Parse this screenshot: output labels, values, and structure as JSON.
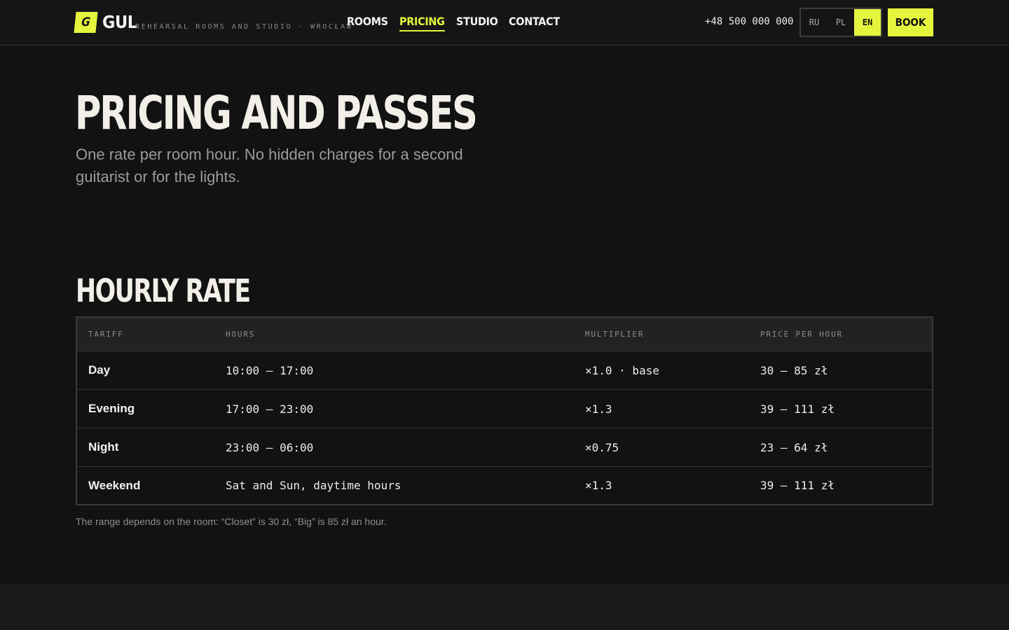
{
  "header": {
    "logo_mark": "G",
    "logo_name": "GUL",
    "tagline": "REHEARSAL ROOMS AND STUDIO · WROCŁAW",
    "nav": [
      {
        "label": "ROOMS"
      },
      {
        "label": "PRICING",
        "active": true
      },
      {
        "label": "STUDIO"
      },
      {
        "label": "CONTACT"
      }
    ],
    "phone": "+48 500 000 000",
    "languages": [
      {
        "label": "RU"
      },
      {
        "label": "PL"
      },
      {
        "label": "EN",
        "active": true
      }
    ],
    "book_label": "BOOK"
  },
  "hero": {
    "title": "PRICING AND PASSES",
    "subtitle": "One rate per room hour. No hidden charges for a second guitarist or for the lights."
  },
  "hourly": {
    "title": "HOURLY RATE",
    "columns": [
      "TARIFF",
      "HOURS",
      "MULTIPLIER",
      "PRICE PER HOUR"
    ],
    "rows": [
      {
        "tariff": "Day",
        "hours": "10:00 — 17:00",
        "multiplier": "×1.0 · base",
        "price": "30 — 85 zł"
      },
      {
        "tariff": "Evening",
        "hours": "17:00 — 23:00",
        "multiplier": "×1.3",
        "price": "39 — 111 zł"
      },
      {
        "tariff": "Night",
        "hours": "23:00 — 06:00",
        "multiplier": "×0.75",
        "price": "23 — 64 zł"
      },
      {
        "tariff": "Weekend",
        "hours": "Sat and Sun, daytime hours",
        "multiplier": "×1.3",
        "price": "39 — 111 zł"
      }
    ],
    "footnote": "The range depends on the room: “Closet” is 30 zł, “Big” is 85 zł an hour."
  },
  "colors": {
    "accent": "#e5f53d",
    "background": "#121212"
  }
}
